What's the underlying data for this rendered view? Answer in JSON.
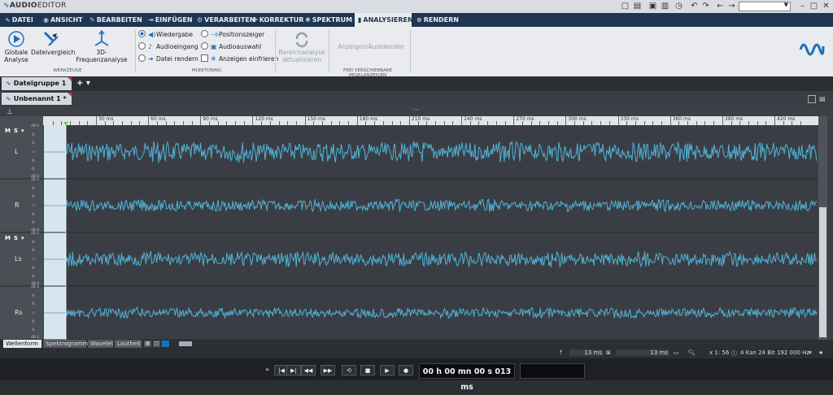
{
  "app": {
    "title_prefix": "AUDIO",
    "title_suffix": "EDITOR"
  },
  "menu_tabs": [
    {
      "label": "DATEI",
      "icon": "file-wave-icon"
    },
    {
      "label": "ANSICHT",
      "icon": "eye-icon"
    },
    {
      "label": "BEARBEITEN",
      "icon": "edit-icon"
    },
    {
      "label": "EINFÜGEN",
      "icon": "insert-icon"
    },
    {
      "label": "VERARBEITEN",
      "icon": "process-icon"
    },
    {
      "label": "KORREKTUR",
      "icon": "wrench-icon"
    },
    {
      "label": "SPEKTRUM",
      "icon": "spectrum-icon"
    },
    {
      "label": "ANALYSIEREN",
      "icon": "analyze-bars-icon",
      "active": true
    },
    {
      "label": "RENDERN",
      "icon": "render-icon"
    }
  ],
  "ribbon": {
    "werkzeuge": {
      "label": "WERKZEUGE",
      "globale_line1": "Globale",
      "globale_line2": "Analyse",
      "dateivergleich": "Dateivergleich",
      "freq3d": "3D-Frequenzanalyse"
    },
    "monitoring": {
      "label": "MONITORING",
      "col1": [
        "Wiedergabe",
        "Audioeingang",
        "Datei rendern"
      ],
      "col2": [
        "Positionszeiger",
        "Audioauswahl",
        "Anzeigen einfrieren"
      ],
      "selected_index": 0
    },
    "bereich_line1": "Bereichanalyse",
    "bereich_line2": "aktualisieren",
    "anzeigen": "Anzeigen/Ausblenden",
    "frei_label": "FREI VERSCHIEBBARE PEGELANZEIGEN"
  },
  "file_group": {
    "tab_label": "Dateigruppe 1",
    "add_label": "+ ▾"
  },
  "document": {
    "tab_label": "Unbenannt 1 *"
  },
  "ruler": {
    "ticks": [
      "30 ms",
      "60 ms",
      "90 ms",
      "120 ms",
      "150 ms",
      "180 ms",
      "210 ms",
      "240 ms",
      "270 ms",
      "300 ms",
      "330 ms",
      "360 ms",
      "390 ms",
      "420 ms"
    ]
  },
  "channels": [
    {
      "label": "L"
    },
    {
      "label": "R"
    },
    {
      "label": "Ls"
    },
    {
      "label": "Rs"
    }
  ],
  "channel_header": {
    "m": "M",
    "s": "S"
  },
  "scale_labels": [
    "dB 0",
    "-6",
    "-6",
    "-∞",
    "-6",
    "-6",
    "dB 0"
  ],
  "bottom_tabs": [
    "Wellenform",
    "Spektrogramm",
    "Wavelet",
    "Lautheit"
  ],
  "status": {
    "cursor": "13 ms",
    "selection": "13 ms",
    "zoom": "x 1: 56",
    "format": "4 Kan 24 Bit 192 000 Hz"
  },
  "transport": {
    "timecode": "00 h 00 mn 00 s 013 ms"
  },
  "colors": {
    "accent": "#1b6fc0",
    "wave": "#4fb3d9",
    "tabbar": "#1f3550"
  }
}
